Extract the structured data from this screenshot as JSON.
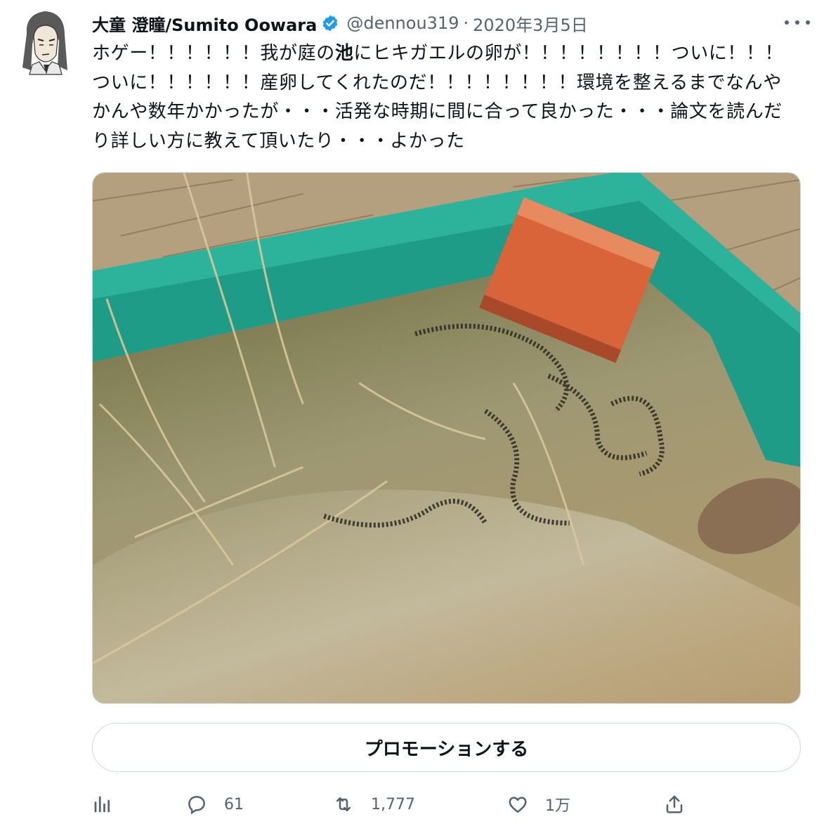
{
  "user": {
    "display_name": "大童 澄瞳/Sumito Oowara",
    "handle": "@dennou319",
    "separator": "·",
    "date": "2020年3月5日"
  },
  "tweet": {
    "text_before": "ホゲー！！！！！！我が庭の",
    "text_bold": "池",
    "text_after": "にヒキガエルの卵が！！！！！！！！ついに！！！ついに！！！！！！産卵してくれたのだ！！！！！！！！環境を整えるまでなんやかんや数年かかったが・・・活発な時期に間に合って良かった・・・論文を読んだり詳しい方に教えて頂いたり・・・よかった"
  },
  "promo_button": {
    "label": "プロモーションする"
  },
  "actions": {
    "analytics": {
      "icon": "analytics-icon"
    },
    "reply": {
      "icon": "reply-icon",
      "count": "61"
    },
    "retweet": {
      "icon": "retweet-icon",
      "count": "1,777"
    },
    "like": {
      "icon": "heart-icon",
      "count": "1万"
    },
    "share": {
      "icon": "share-icon"
    }
  },
  "colors": {
    "verified": "#1d9bf0",
    "secondary_text": "#536471",
    "border": "#cfd9de"
  }
}
